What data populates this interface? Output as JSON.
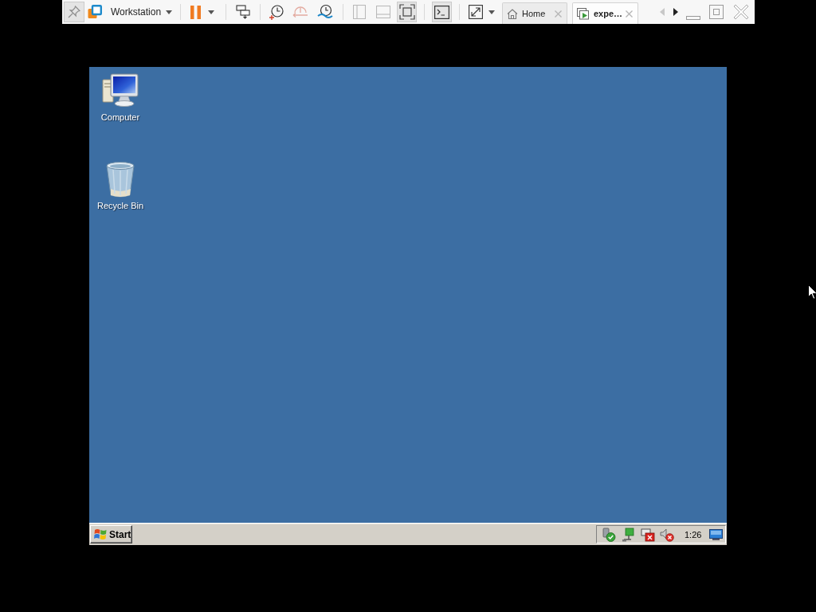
{
  "toolbar": {
    "pin": {
      "pressed": true
    },
    "menu": {
      "label": "Workstation"
    },
    "snapshot_buttons": [
      {
        "disabled": false
      },
      {
        "disabled": true
      },
      {
        "disabled": false
      }
    ],
    "view_buttons": [
      {
        "pressed": false,
        "disabled": true
      },
      {
        "pressed": false,
        "disabled": true
      },
      {
        "pressed": true,
        "disabled": false
      }
    ],
    "console_button": {
      "pressed": true
    },
    "tabs": [
      {
        "label": "Home",
        "selected": false
      },
      {
        "label": "expe…",
        "selected": true
      }
    ],
    "scroll_left": {
      "disabled": true
    },
    "scroll_right": {
      "disabled": false
    }
  },
  "desktop": {
    "icons": [
      {
        "kind": "computer",
        "label": "Computer"
      },
      {
        "kind": "recycle-bin",
        "label": "Recycle Bin"
      }
    ]
  },
  "taskbar": {
    "start": {
      "label": "Start"
    },
    "tray": {
      "clock": "1:26"
    }
  }
}
